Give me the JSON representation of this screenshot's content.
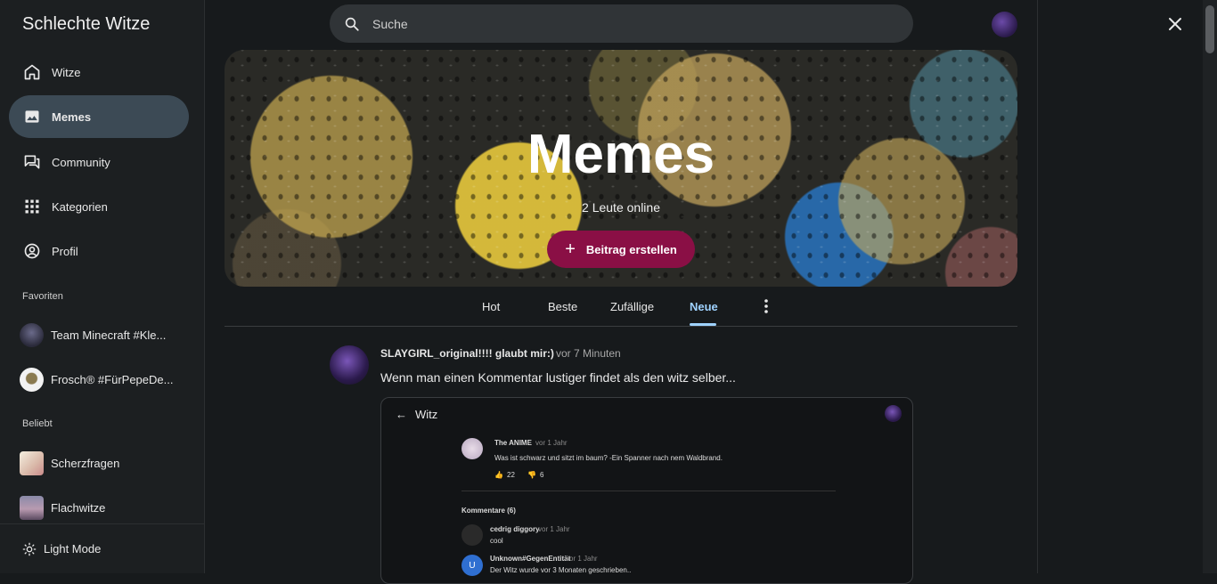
{
  "sidebar": {
    "app_title": "Schlechte Witze",
    "nav": [
      {
        "label": "Witze",
        "icon": "home-icon"
      },
      {
        "label": "Memes",
        "icon": "image-icon"
      },
      {
        "label": "Community",
        "icon": "forum-icon"
      },
      {
        "label": "Kategorien",
        "icon": "grid-icon"
      },
      {
        "label": "Profil",
        "icon": "account-circle-icon"
      }
    ],
    "favorites_label": "Favoriten",
    "favorites": [
      {
        "label": "Team Minecraft #Kle..."
      },
      {
        "label": "Frosch® #FürPepeDe..."
      }
    ],
    "popular_label": "Beliebt",
    "popular": [
      {
        "label": "Scherzfragen"
      },
      {
        "label": "Flachwitze"
      }
    ],
    "light_mode_label": "Light Mode"
  },
  "search": {
    "placeholder": "Suche"
  },
  "banner": {
    "title": "Memes",
    "online": "2 Leute online",
    "create_label": "Beitrag erstellen"
  },
  "tabs": [
    {
      "label": "Hot"
    },
    {
      "label": "Beste"
    },
    {
      "label": "Zufällige"
    },
    {
      "label": "Neue",
      "active": true
    }
  ],
  "post": {
    "author": "SLAYGIRL_original!!!! glaubt mir:)",
    "time": "vor 7 Minuten",
    "text": "Wenn man einen Kommentar lustiger findet als den witz selber...",
    "embed": {
      "title": "Witz",
      "joke_author": "The ANIME",
      "joke_time": "vor 1 Jahr",
      "joke_text": "Was ist schwarz und sitzt im baum? -Ein Spanner nach nem Waldbrand.",
      "likes": "22",
      "dislikes": "6",
      "comments_header": "Kommentare (6)",
      "comments": [
        {
          "author": "cedrig diggory",
          "time": "vor 1 Jahr",
          "text": "cool"
        },
        {
          "author": "Unknown#GegenEntität",
          "time": "vor 1 Jahr",
          "text": "Der Witz wurde vor 3 Monaten geschrieben.."
        }
      ]
    }
  },
  "colors": {
    "accent_active": "#9fd2ff",
    "create_button": "#8a0f45",
    "active_nav_bg": "#3c4a55",
    "background": "#171a1c"
  }
}
